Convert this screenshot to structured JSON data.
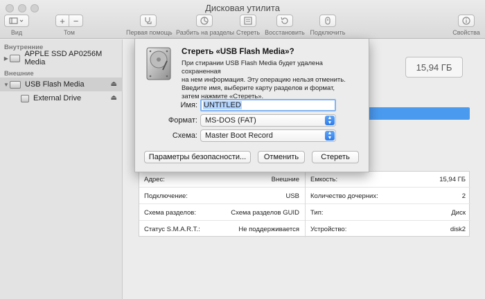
{
  "window": {
    "title": "Дисковая утилита"
  },
  "toolbar": {
    "view_label": "Вид",
    "volume_label": "Том",
    "first_aid_label": "Первая помощь",
    "partition_label": "Разбить на разделы",
    "erase_label": "Стереть",
    "restore_label": "Восстановить",
    "mount_label": "Подключить",
    "info_label": "Свойства"
  },
  "sidebar": {
    "internal_header": "Внутренние",
    "external_header": "Внешние",
    "items": [
      {
        "label": "APPLE SSD AP0256M Media"
      },
      {
        "label": "USB Flash Media"
      },
      {
        "label": "External Drive"
      }
    ]
  },
  "main": {
    "capacity_display": "15,94 ГБ",
    "info_left": [
      {
        "key": "Адрес:",
        "value": "Внешние"
      },
      {
        "key": "Подключение:",
        "value": "USB"
      },
      {
        "key": "Схема разделов:",
        "value": "Схема разделов GUID"
      },
      {
        "key": "Статус S.M.A.R.T.:",
        "value": "Не поддерживается"
      }
    ],
    "info_right": [
      {
        "key": "Емкость:",
        "value": "15,94 ГБ"
      },
      {
        "key": "Количество дочерних:",
        "value": "2"
      },
      {
        "key": "Тип:",
        "value": "Диск"
      },
      {
        "key": "Устройство:",
        "value": "disk2"
      }
    ]
  },
  "sheet": {
    "title": "Стереть «USB Flash Media»?",
    "message_lines": [
      "При стирании USB Flash Media будет удалена сохраненная",
      "на нем информация. Эту операцию нельзя отменить.",
      "Введите имя, выберите карту разделов и формат,",
      "затем нажмите «Стереть»."
    ],
    "name_label": "Имя:",
    "name_value": "UNTITLED",
    "format_label": "Формат:",
    "format_value": "MS-DOS (FAT)",
    "scheme_label": "Схема:",
    "scheme_value": "Master Boot Record",
    "security_button": "Параметры безопасности...",
    "cancel_button": "Отменить",
    "erase_button": "Стереть"
  },
  "colors": {
    "accent": "#3a8bf0",
    "selection": "#b4d5fd"
  }
}
